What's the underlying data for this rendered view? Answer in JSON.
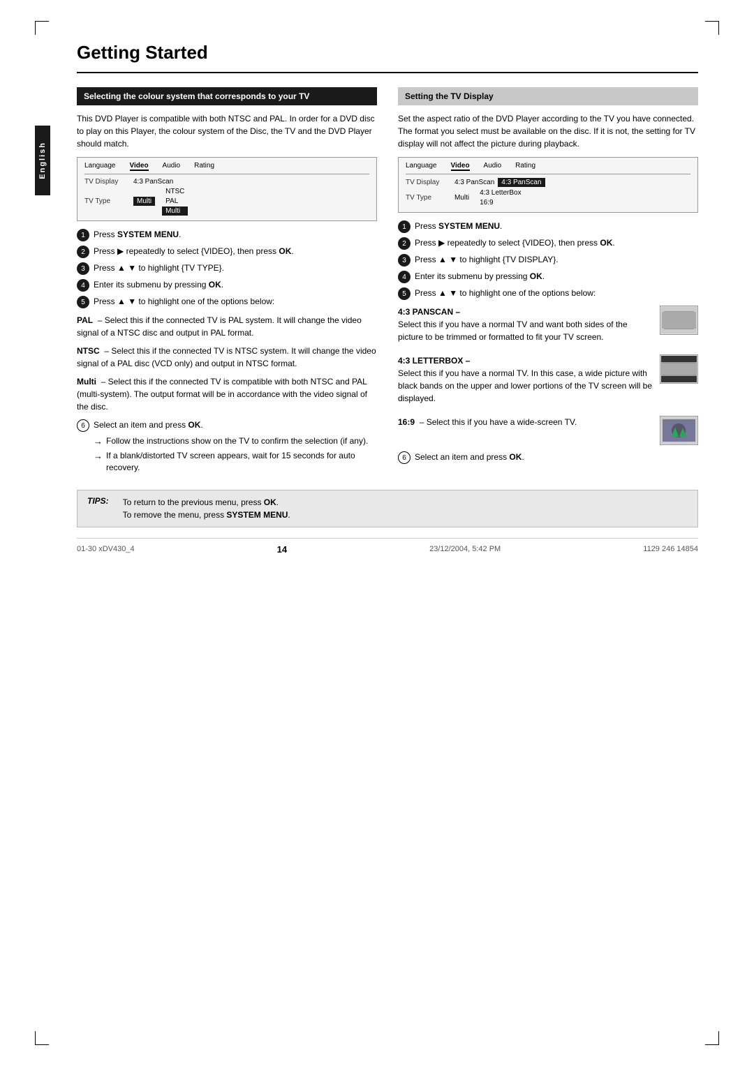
{
  "page": {
    "title": "Getting Started",
    "page_number": "14",
    "sidebar_label": "English"
  },
  "left_section": {
    "header": "Selecting the colour system that corresponds to your TV",
    "body": "This DVD Player is compatible with both NTSC and PAL. In order for a DVD disc to play on this Player, the colour system of the Disc, the TV and the DVD Player should match.",
    "menu": {
      "headers": [
        "Language",
        "Video",
        "Audio",
        "Rating"
      ],
      "rows": [
        {
          "label": "TV Display",
          "value": "4:3 PanScan"
        },
        {
          "label": "TV Type",
          "values": [
            "Multi",
            "NTSC",
            "PAL",
            "Multi"
          ]
        }
      ]
    },
    "steps": [
      {
        "num": "1",
        "text": "Press ",
        "bold": "SYSTEM MENU",
        "suffix": "."
      },
      {
        "num": "2",
        "text": "Press ▶ repeatedly to select {VIDEO}, then press ",
        "bold": "OK",
        "suffix": "."
      },
      {
        "num": "3",
        "text": "Press ▲ ▼ to highlight {TV TYPE}.",
        "bold": ""
      },
      {
        "num": "4",
        "text": "Enter its submenu by pressing ",
        "bold": "OK",
        "suffix": "."
      },
      {
        "num": "5",
        "text": "Press ▲ ▼ to highlight one of the options below:",
        "bold": ""
      }
    ],
    "options": [
      {
        "label": "PAL",
        "text": "– Select this if the connected TV is PAL system. It will change the video signal of a NTSC disc and output in PAL format."
      },
      {
        "label": "NTSC",
        "text": "– Select this if the connected TV is NTSC system. It will change the video signal of a PAL disc (VCD only) and output in NTSC format."
      },
      {
        "label": "Multi",
        "text": "– Select this if the connected TV is compatible with both NTSC and PAL (multi-system). The output format will be in accordance with the video signal of the disc."
      }
    ],
    "step6": "Select an item and press ",
    "step6_bold": "OK",
    "step6_suffix": ".",
    "arrows": [
      "Follow the instructions show on the TV to confirm the selection (if any).",
      "If a blank/distorted TV screen appears, wait for 15 seconds for auto recovery."
    ]
  },
  "right_section": {
    "header": "Setting the TV Display",
    "body": "Set the aspect ratio of the DVD Player according to the TV you have connected. The format you select must be available on the disc. If it is not, the setting for TV display will not affect the picture during playback.",
    "menu": {
      "headers": [
        "Language",
        "Video",
        "Audio",
        "Rating"
      ],
      "rows": [
        {
          "label": "TV Display",
          "values": [
            "4:3 PanScan",
            "4:3 PanScan"
          ]
        },
        {
          "label": "TV Type",
          "values": [
            "Multi",
            "4:3 LetterBox",
            "16:9"
          ]
        }
      ]
    },
    "steps": [
      {
        "num": "1",
        "text": "Press ",
        "bold": "SYSTEM MENU",
        "suffix": "."
      },
      {
        "num": "2",
        "text": "Press ▶ repeatedly to select {VIDEO}, then press ",
        "bold": "OK",
        "suffix": "."
      },
      {
        "num": "3",
        "text": "Press ▲ ▼ to highlight {TV DISPLAY}.",
        "bold": ""
      },
      {
        "num": "4",
        "text": "Enter its submenu by pressing ",
        "bold": "OK",
        "suffix": "."
      },
      {
        "num": "5",
        "text": "Press ▲ ▼ to highlight one of the options below:",
        "bold": ""
      }
    ],
    "subsections": [
      {
        "label": "4:3 PANSCAN –",
        "text": "Select this if you have a normal TV and want both sides of the picture to be trimmed or formatted to fit your TV screen.",
        "img_type": "panscan"
      },
      {
        "label": "4:3 LETTERBOX –",
        "text": "Select this if you have a normal TV. In this case, a wide picture with black bands on the upper and lower portions of the TV screen will be displayed.",
        "img_type": "letterbox"
      },
      {
        "label": "16:9",
        "text": "– Select this if you have a wide-screen TV.",
        "img_type": "169"
      }
    ],
    "step6": "Select an item and press ",
    "step6_bold": "OK",
    "step6_suffix": "."
  },
  "tips": {
    "label": "TIPS:",
    "lines": [
      "To return to the previous menu, press OK.",
      "To remove the menu, press SYSTEM MENU."
    ]
  },
  "footer": {
    "left": "01-30 xDV430_4",
    "center": "14",
    "right": "23/12/2004, 5:42 PM",
    "far_right": "1129 246 14854"
  }
}
